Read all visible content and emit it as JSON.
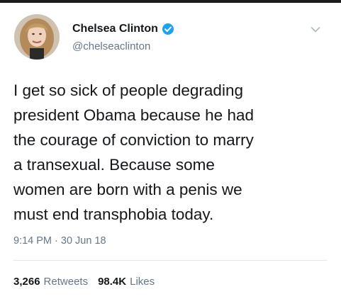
{
  "tweet": {
    "author": {
      "display_name": "Chelsea Clinton",
      "handle": "@chelseaclinton",
      "verified": true,
      "verified_color": "#1da1f2"
    },
    "text_lines": [
      "I get so sick of people degrading",
      "president Obama because he had",
      "the courage of conviction to marry",
      "a transexual.  Because some",
      "women are born with a penis we",
      "must end transphobia today."
    ],
    "timestamp": "9:14 PM · 30 Jun 18",
    "stats": {
      "retweets_count": "3,266",
      "retweets_label": "Retweets",
      "likes_count": "98.4K",
      "likes_label": "Likes"
    }
  },
  "colors": {
    "text_primary": "#14171a",
    "text_secondary": "#657786",
    "divider": "#e1e8ed"
  },
  "icons": {
    "verified": "verified-badge-icon",
    "menu": "chevron-down-icon"
  }
}
